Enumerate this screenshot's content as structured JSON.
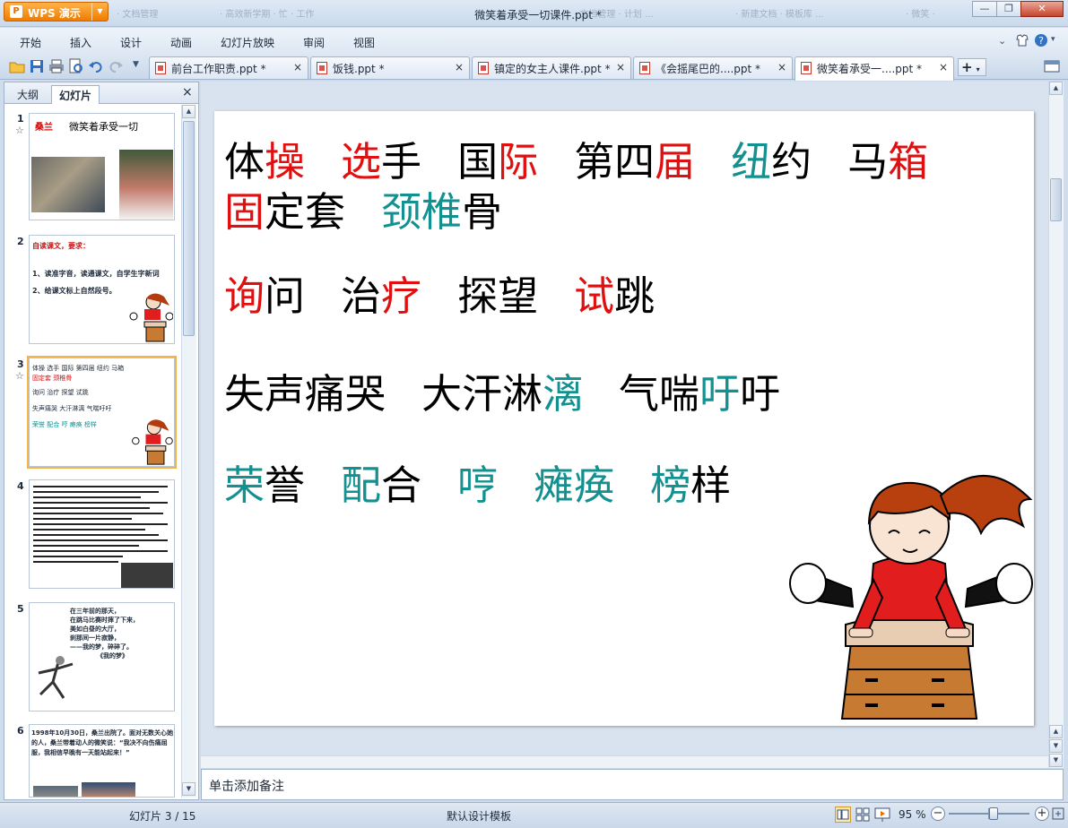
{
  "app": {
    "menu_button_label": "WPS 演示",
    "window_title": "微笑着承受一切课件.ppt *",
    "ghost_tabs": [
      "· 文档管理",
      "· 高效新学期 · 忙 · 工作",
      "· 文档管理 · 文件 ...",
      "· 文档管理 · 计划 ...",
      "· 新建文档 · 模板库 ...",
      "· 微笑 ·"
    ]
  },
  "window_controls": {
    "minimize": "—",
    "restore": "❐",
    "close": "✕"
  },
  "menu": {
    "items": [
      "开始",
      "插入",
      "设计",
      "动画",
      "幻灯片放映",
      "审阅",
      "视图"
    ]
  },
  "doc_tabs": [
    {
      "label": "前台工作职责.ppt *",
      "close": "×"
    },
    {
      "label": "饭钱.ppt *",
      "close": "×"
    },
    {
      "label": "镇定的女主人课件.ppt *",
      "close": "×"
    },
    {
      "label": "《会摇尾巴的....ppt *",
      "close": "×"
    },
    {
      "label": "微笑着承受一....ppt *",
      "close": "×"
    }
  ],
  "new_tab_label": "+",
  "left_panel": {
    "tabs": [
      "大纲",
      "幻灯片"
    ],
    "close": "×",
    "thumbs": [
      {
        "num": "1",
        "star": "☆",
        "name_red": "桑兰",
        "title": "微笑着承受一切"
      },
      {
        "num": "2",
        "title_red": "自读课文，要求：",
        "line1": "1、读准字音，读通课文，自学生字新词",
        "line2": "2、给课文标上自然段号。"
      },
      {
        "num": "3",
        "star": "☆",
        "l1": "体操 选手 国际 第四届 纽约 马箱",
        "l2": "固定套 颈椎骨",
        "l3": "询问 治疗 探望 试跳",
        "l4": "失声痛哭 大汗淋漓 气喘吁吁",
        "l5": "荣誉 配合 哼 瘫痪 榜样"
      },
      {
        "num": "4"
      },
      {
        "num": "5",
        "lines": [
          "在三年前的那天，",
          "在跳马比赛时摔了下来，",
          "美如白昼的大厅，",
          "刹那间一片寂静，",
          "——我的梦，碎碎了。",
          "《我的梦》"
        ]
      },
      {
        "num": "6",
        "text": "1998年10月30日，桑兰出院了。面对无数关心她的人，桑兰带着动人的微笑说：“我决不向伤痛屈服，我相信早晚有一天能站起来！”"
      }
    ]
  },
  "slide": {
    "lines": [
      [
        [
          {
            "t": "体",
            "c": "K"
          },
          {
            "t": "操",
            "c": "R"
          }
        ],
        [
          {
            "t": "选",
            "c": "R"
          },
          {
            "t": "手",
            "c": "K"
          }
        ],
        [
          {
            "t": "国",
            "c": "K"
          },
          {
            "t": "际",
            "c": "R"
          }
        ],
        [
          {
            "t": "第四",
            "c": "K"
          },
          {
            "t": "届",
            "c": "R"
          }
        ],
        [
          {
            "t": "纽",
            "c": "T"
          },
          {
            "t": "约",
            "c": "K"
          }
        ],
        [
          {
            "t": "马",
            "c": "K"
          },
          {
            "t": "箱",
            "c": "R"
          }
        ]
      ],
      [
        [
          {
            "t": "固",
            "c": "R"
          },
          {
            "t": "定套",
            "c": "K"
          }
        ],
        [
          {
            "t": "颈椎",
            "c": "T"
          },
          {
            "t": "骨",
            "c": "K"
          }
        ]
      ],
      [
        [
          {
            "t": "询",
            "c": "R"
          },
          {
            "t": "问",
            "c": "K"
          }
        ],
        [
          {
            "t": "治",
            "c": "K"
          },
          {
            "t": "疗",
            "c": "R"
          }
        ],
        [
          {
            "t": "探望",
            "c": "K"
          }
        ],
        [
          {
            "t": "试",
            "c": "R"
          },
          {
            "t": "跳",
            "c": "K"
          }
        ]
      ],
      [
        [
          {
            "t": "失声痛哭",
            "c": "K"
          }
        ],
        [
          {
            "t": "大汗淋",
            "c": "K"
          },
          {
            "t": "漓",
            "c": "T"
          }
        ],
        [
          {
            "t": "气喘",
            "c": "K"
          },
          {
            "t": "吁",
            "c": "T"
          },
          {
            "t": "吁",
            "c": "K"
          }
        ]
      ],
      [
        [
          {
            "t": "荣",
            "c": "T"
          },
          {
            "t": "誉",
            "c": "K"
          }
        ],
        [
          {
            "t": "配",
            "c": "T"
          },
          {
            "t": "合",
            "c": "K"
          }
        ],
        [
          {
            "t": "哼",
            "c": "T"
          }
        ],
        [
          {
            "t": "瘫痪",
            "c": "T"
          }
        ],
        [
          {
            "t": "榜",
            "c": "T"
          },
          {
            "t": "样",
            "c": "K"
          }
        ]
      ]
    ]
  },
  "notes_placeholder": "单击添加备注",
  "status": {
    "slide_counter": "幻灯片 3 / 15",
    "template": "默认设计模板",
    "zoom": "95 %",
    "zoom_level_fraction": 0.55,
    "zoom_minus": "−",
    "zoom_plus": "+"
  },
  "colors": {
    "red": "#e01010",
    "teal": "#139090",
    "black": "#000000",
    "accent": "#f07c00"
  }
}
